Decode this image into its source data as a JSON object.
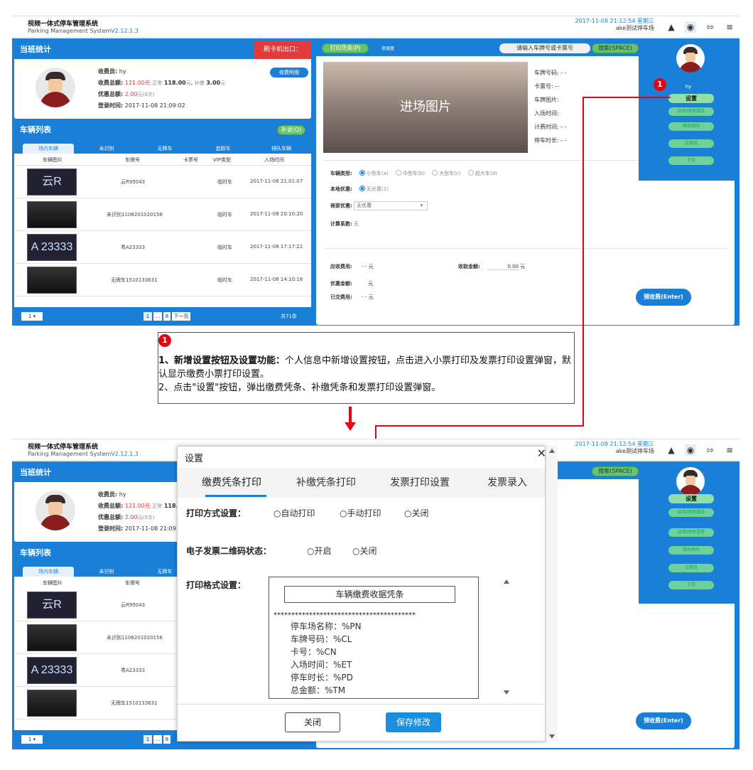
{
  "app": {
    "title": "视频一体式停车管理系统",
    "subtitle": "Parking Management System",
    "version": "V2.12.1.3",
    "datetime": "2017-11-08 21:12:54 星期三",
    "lot": "ake测试停车场"
  },
  "shift": {
    "header": "当班统计",
    "banner": "刷卡机出口：",
    "collector_label": "收费员:",
    "collector": "hy",
    "total_label": "收费总额:",
    "total": "121.00",
    "total_unit": "元",
    "normal_label": "正常",
    "normal": "118.00",
    "normal_unit": "元",
    "extra_label": "补缴",
    "extra": "3.00",
    "extra_unit": "元",
    "discount_label": "优惠总额:",
    "discount": "2.00",
    "discount_unit": "元(0次)",
    "login_label": "登录时间:",
    "login": "2017-11-08 21:09:02",
    "detail_btn": "收费明细"
  },
  "vehicles": {
    "header": "车辆列表",
    "makeup_btn": "补录(Q)",
    "tabs": [
      "场内车辆",
      "未识别",
      "无牌车",
      "追踪车",
      "排队车辆"
    ],
    "columns": [
      "车辆图片",
      "车牌号",
      "卡票号",
      "VIP类型",
      "入场时间"
    ],
    "rows": [
      {
        "img": "云R 95043",
        "plate": "云R95043",
        "card": "",
        "vip": "临时车",
        "time": "2017-11-08 21:01:07"
      },
      {
        "img": "",
        "plate": "未识别1108201020156",
        "card": "",
        "vip": "临时车",
        "time": "2017-11-08 20:10:20"
      },
      {
        "img": "A 23333",
        "plate": "粤A23333",
        "card": "",
        "vip": "临时车",
        "time": "2017-11-08 17:17:22"
      },
      {
        "img": "",
        "plate": "无牌车1510133631",
        "card": "",
        "vip": "临时车",
        "time": "2017-11-08 14:10:16"
      }
    ],
    "page_size": "1",
    "pages": [
      "1",
      "...",
      "8",
      "下一页"
    ],
    "total": "共71条"
  },
  "right": {
    "print_btn": "打印凭条(P)",
    "count": "收银盘",
    "search_placeholder": "请输入车牌号或卡票号",
    "search_btn": "搜索(SPACE)",
    "photo": "进场图片",
    "plate_label": "车牌号码: - -",
    "card_label": "卡票号: --",
    "plate_img_label": "车牌图片:",
    "in_time_label": "入场时间:",
    "charge_time_label": "计费时间: - -",
    "duration_label": "停车时长: - -",
    "car_type_label": "车辆类型:",
    "car_types": [
      "小型车(a)",
      "中型车(b)",
      "大型车(c)",
      "超大车(d)"
    ],
    "local_discount_label": "本地优惠:",
    "local_discount": "无优惠(1)",
    "merchant_label": "商家优惠:",
    "merchant_value": "无优惠",
    "coef_label": "计算系数:",
    "coef": "无",
    "due_label": "应收费用:",
    "due": "- -  元",
    "received_label": "收取金额:",
    "received": "0.00",
    "received_unit": "元",
    "discount_label": "优惠金额:",
    "discount": "元",
    "paid_label": "已交费用:",
    "paid": "- -  元",
    "prepay_btn": "预收费(Enter)"
  },
  "user_popup": {
    "name": "hy",
    "buttons_top": [
      "设置",
      "启用/停用通道",
      "修改密码",
      "交接班",
      "下班"
    ],
    "buttons_bottom": [
      "设置",
      "启用/停用通道",
      "启用/停用语音",
      "修改密码",
      "交接班",
      "下班"
    ]
  },
  "annotation": {
    "badge": "1",
    "bold": "1、新增设置按钮及设置功能：",
    "text1": "个人信息中新增设置按钮，点击进入小票打印及发票打印设置弹窗，默认显示缴费小票打印设置。",
    "text2": "2、点击\"设置\"按钮，弹出缴费凭条、补缴凭条和发票打印设置弹窗。"
  },
  "dialog": {
    "title": "设置",
    "tabs": [
      "缴费凭条打印",
      "补缴凭条打印",
      "发票打印设置",
      "发票录入"
    ],
    "print_mode_label": "打印方式设置：",
    "print_modes": [
      "○自动打印",
      "○手动打印",
      "○关闭"
    ],
    "qr_label": "电子发票二维码状态：",
    "qr_modes": [
      "○开启",
      "○关闭"
    ],
    "format_label": "打印格式设置：",
    "receipt_title": "车辆缴费收据凭条",
    "stars": "****************************************",
    "lines": [
      "停车场名称：%PN",
      "车牌号码：%CL",
      "卡号：%CN",
      "入场时间：%ET",
      "停车时长：%PD",
      "总金额：%TM"
    ],
    "close_btn": "关闭",
    "save_btn": "保存修改"
  }
}
